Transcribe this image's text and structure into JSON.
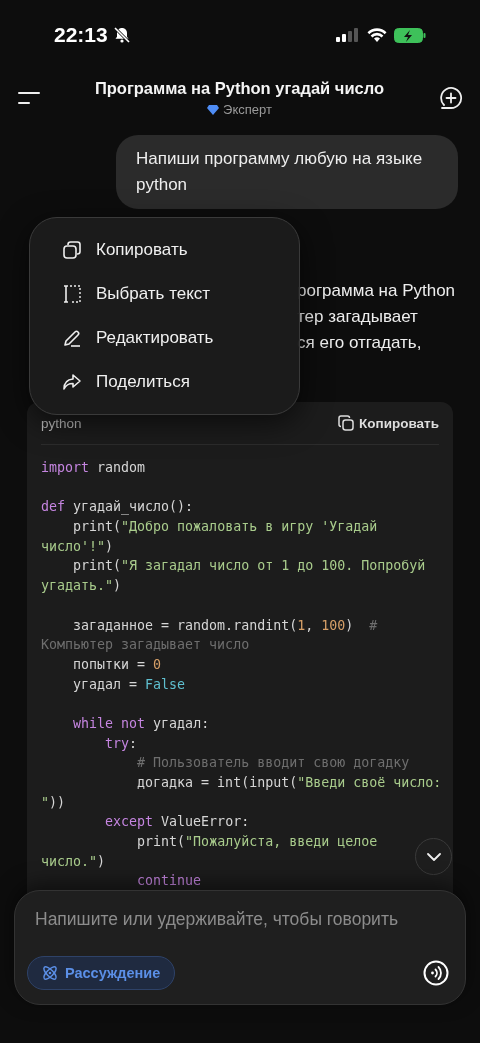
{
  "status_bar": {
    "time": "22:13"
  },
  "header": {
    "title": "Программа на Python угадай число",
    "model": "Эксперт"
  },
  "user_message": "Напиши программу любую на языке python",
  "assistant_lines": [
    "рограмма на Python",
    "тер загадывает",
    "ся его отгадать,"
  ],
  "context_menu": [
    {
      "kind": "copy",
      "label": "Копировать"
    },
    {
      "kind": "select",
      "label": "Выбрать текст"
    },
    {
      "kind": "edit",
      "label": "Редактировать"
    },
    {
      "kind": "share",
      "label": "Поделиться"
    }
  ],
  "code_block": {
    "language": "python",
    "copy_label": "Копировать",
    "lines": [
      [
        {
          "kind": "kw",
          "text": "import"
        },
        {
          "kind": "plain",
          "text": " random"
        }
      ],
      {
        "kind": "blank"
      },
      [
        {
          "kind": "kw",
          "text": "def"
        },
        {
          "kind": "plain",
          "text": " угадай_число():"
        }
      ],
      [
        {
          "kind": "plain",
          "text": "    print("
        },
        {
          "kind": "str",
          "text": "\"Добро пожаловать в игру 'Угадай"
        }
      ],
      [
        {
          "kind": "str",
          "text": "число'!\""
        },
        {
          "kind": "plain",
          "text": ")"
        }
      ],
      [
        {
          "kind": "plain",
          "text": "    print("
        },
        {
          "kind": "str",
          "text": "\"Я загадал число от 1 до 100. Попробуй"
        }
      ],
      [
        {
          "kind": "str",
          "text": "угадать.\""
        },
        {
          "kind": "plain",
          "text": ")"
        }
      ],
      {
        "kind": "blank"
      },
      [
        {
          "kind": "plain",
          "text": "    загаданное = random.randint("
        },
        {
          "kind": "num",
          "text": "1"
        },
        {
          "kind": "plain",
          "text": ", "
        },
        {
          "kind": "num",
          "text": "100"
        },
        {
          "kind": "plain",
          "text": ")  "
        },
        {
          "kind": "comment",
          "text": "#"
        }
      ],
      [
        {
          "kind": "comment",
          "text": "Компьютер загадывает число"
        }
      ],
      [
        {
          "kind": "plain",
          "text": "    попытки = "
        },
        {
          "kind": "num",
          "text": "0"
        }
      ],
      [
        {
          "kind": "plain",
          "text": "    угадал = "
        },
        {
          "kind": "const",
          "text": "False"
        }
      ],
      {
        "kind": "blank"
      },
      [
        {
          "kind": "kw",
          "text": "    while"
        },
        {
          "kind": "kw",
          "text": " not"
        },
        {
          "kind": "plain",
          "text": " угадал:"
        }
      ],
      [
        {
          "kind": "kw",
          "text": "        try"
        },
        {
          "kind": "plain",
          "text": ":"
        }
      ],
      [
        {
          "kind": "comment",
          "text": "            # Пользователь вводит свою догадку"
        }
      ],
      [
        {
          "kind": "plain",
          "text": "            догадка = int(input("
        },
        {
          "kind": "str",
          "text": "\"Введи своё число:"
        }
      ],
      [
        {
          "kind": "str",
          "text": "\""
        },
        {
          "kind": "plain",
          "text": "))"
        }
      ],
      [
        {
          "kind": "kw",
          "text": "        except"
        },
        {
          "kind": "plain",
          "text": " ValueError:"
        }
      ],
      [
        {
          "kind": "plain",
          "text": "            print("
        },
        {
          "kind": "str",
          "text": "\"Пожалуйста, введи целое"
        }
      ],
      [
        {
          "kind": "str",
          "text": "число.\""
        },
        {
          "kind": "plain",
          "text": ")"
        }
      ],
      [
        {
          "kind": "kw",
          "text": "            continue"
        }
      ]
    ]
  },
  "composer": {
    "placeholder": "Напишите или удерживайте, чтобы говорить",
    "reasoning": {
      "label": "Рассуждение",
      "selected": true
    }
  }
}
